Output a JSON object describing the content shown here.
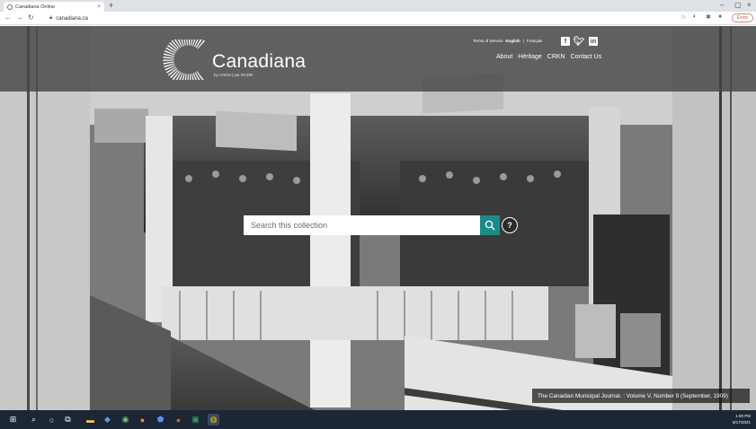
{
  "browser": {
    "tab_title": "Canadiana Online",
    "tab_close": "×",
    "new_tab": "+",
    "url": "canadiana.ca",
    "error_label": "Error",
    "window_controls": [
      "–",
      "▢",
      "×"
    ]
  },
  "header": {
    "site_name": "Canadiana",
    "tagline": "by CRKN | par RCDR",
    "top_links": {
      "terms": "Terms of Service",
      "english": "English",
      "separator": "|",
      "francais": "Français"
    },
    "social": [
      "f",
      "t",
      "in"
    ],
    "nav": [
      "About",
      "Héritage",
      "CRKN",
      "Contact Us"
    ]
  },
  "search": {
    "placeholder": "Search this collection",
    "help_label": "?"
  },
  "caption": "The Canadian Municipal Journal. : Volume V, Number 9 (September, 1909)",
  "taskbar": {
    "time": "1:00 PM",
    "date": "8/17/2021"
  },
  "colors": {
    "header_band": "#464646",
    "search_button": "#1d8a87",
    "taskbar": "#1c2634"
  }
}
